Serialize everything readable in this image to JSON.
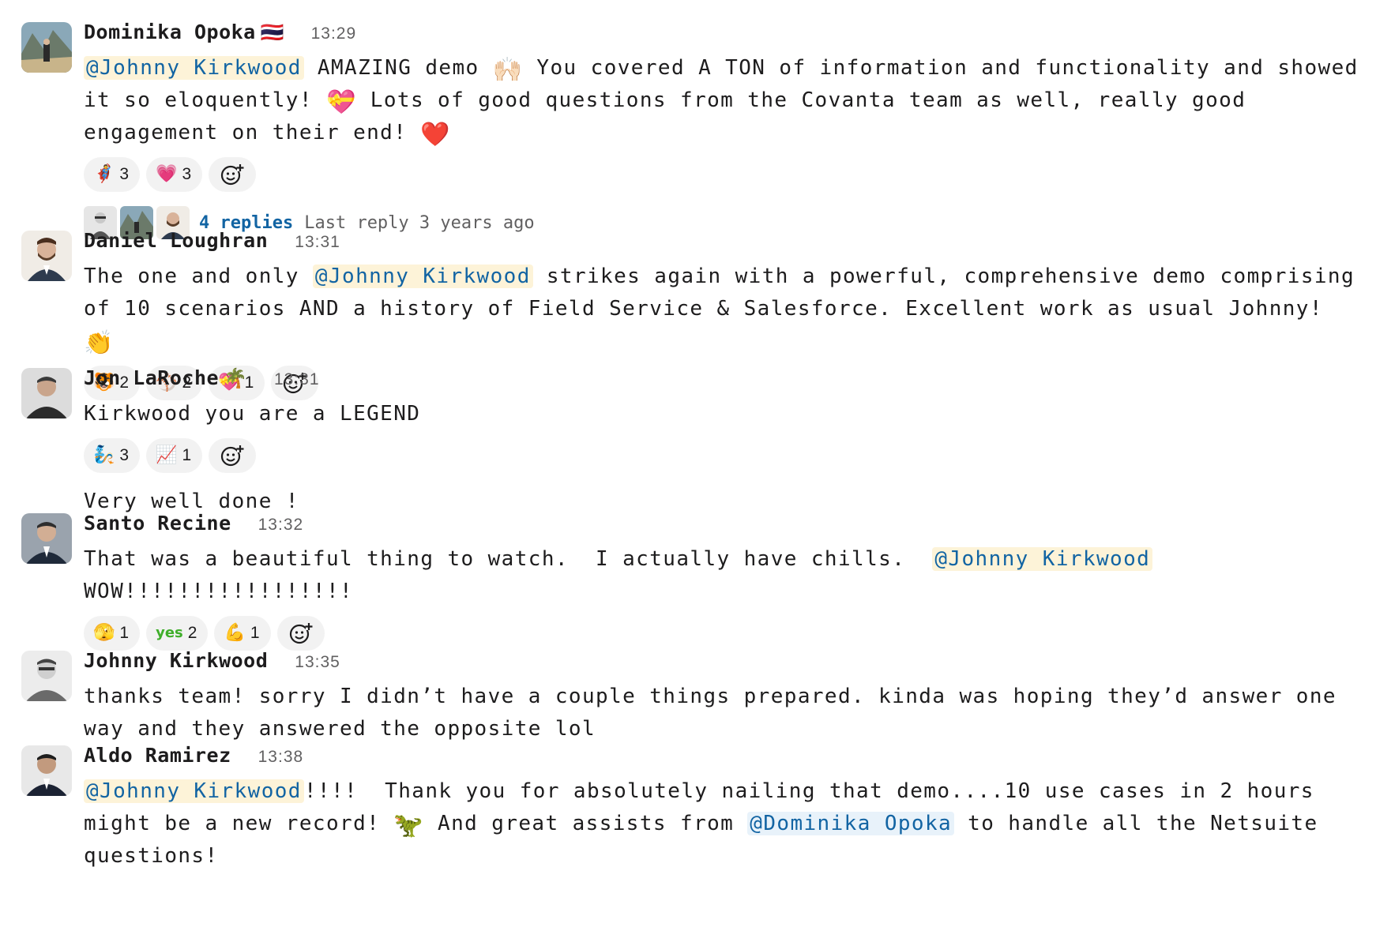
{
  "messages": [
    {
      "author": "Dominika Opoka",
      "status_emoji": "🇹🇭",
      "time": "13:29",
      "parts": [
        {
          "mention": "@Johnny Kirkwood"
        },
        {
          "text": " AMAZING demo "
        },
        {
          "emoji": "🙌🏻"
        },
        {
          "text": " You covered A TON of information and functionality and showed it so eloquently! "
        },
        {
          "emoji": "💝"
        },
        {
          "text": " Lots of good questions from the Covanta team as well, really good engagement on their end! "
        },
        {
          "emoji": "❤️"
        }
      ],
      "reactions": [
        {
          "emoji": "🦸",
          "count": "3"
        },
        {
          "emoji": "💗",
          "count": "3"
        }
      ],
      "thread": {
        "replies": "4 replies",
        "last_reply": "Last reply 3 years ago"
      }
    },
    {
      "author": "Daniel Loughran",
      "time": "13:31",
      "parts": [
        {
          "text": "The one and only "
        },
        {
          "mention": "@Johnny Kirkwood"
        },
        {
          "text": " strikes again with a powerful, comprehensive demo comprising of 10 scenarios AND a history of Field Service & Salesforce. Excellent work as usual Johnny! "
        },
        {
          "emoji": "👏"
        }
      ],
      "reactions": [
        {
          "emoji": "🐯",
          "count": "2"
        },
        {
          "emoji": "⚾",
          "count": "2"
        },
        {
          "emoji": "💝",
          "count": "1"
        }
      ]
    },
    {
      "author": "Jon LaRoche",
      "status_emoji": "🌴",
      "time": "13:31",
      "parts": [
        {
          "text": "Kirkwood you are a LEGEND"
        }
      ],
      "reactions": [
        {
          "emoji": "🧞",
          "count": "3"
        },
        {
          "emoji": "📈",
          "count": "1"
        }
      ],
      "followup": "Very well done !"
    },
    {
      "author": "Santo Recine",
      "time": "13:32",
      "parts": [
        {
          "text": "That was a beautiful thing to watch.  I actually have chills.  "
        },
        {
          "mention": "@Johnny Kirkwood"
        },
        {
          "text": "\nWOW!!!!!!!!!!!!!!!!!"
        }
      ],
      "reactions": [
        {
          "emoji": "🫣",
          "count": "1"
        },
        {
          "emoji": "yes",
          "count": "2"
        },
        {
          "emoji": "💪",
          "count": "1"
        }
      ]
    },
    {
      "author": "Johnny Kirkwood",
      "time": "13:35",
      "parts": [
        {
          "text": "thanks team! sorry I didn’t have a couple things prepared. kinda was hoping they’d answer one way and they answered the opposite lol"
        }
      ]
    },
    {
      "author": "Aldo Ramirez",
      "time": "13:38",
      "parts": [
        {
          "mention": "@Johnny Kirkwood"
        },
        {
          "text": "!!!!  Thank you for absolutely nailing that demo....10 use cases in 2 hours might be a new record! "
        },
        {
          "emoji": "🦖"
        },
        {
          "text": " And great assists from "
        },
        {
          "mention_alt": "@Dominika Opoka"
        },
        {
          "text": " to handle all the Netsuite questions!"
        }
      ]
    }
  ],
  "add_reaction_icon": "add-emoji-icon",
  "colors": {
    "mention_bg": "#fdf3d8",
    "mention_text": "#1264a3",
    "reaction_bg": "#f2f2f2",
    "link": "#1264a3"
  }
}
